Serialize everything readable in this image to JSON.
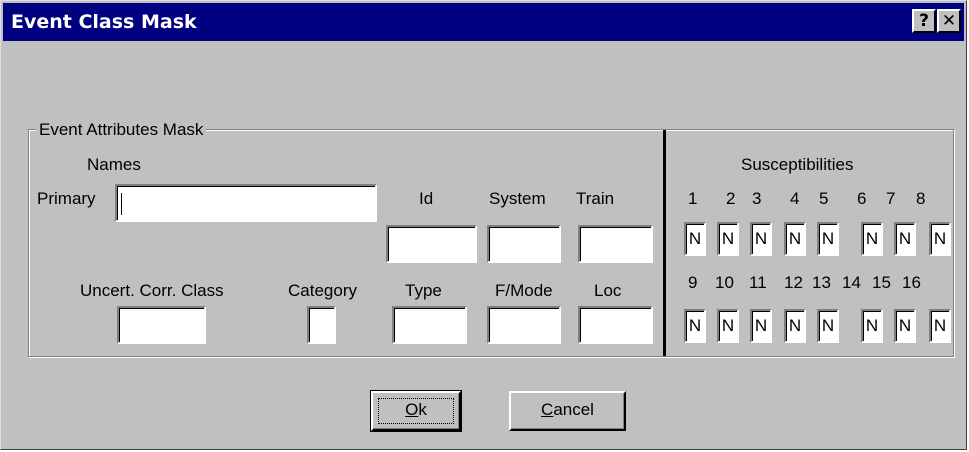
{
  "window": {
    "title": "Event Class Mask"
  },
  "titlebar_buttons": {
    "help": "?",
    "close": "✕"
  },
  "group": {
    "label": "Event Attributes Mask"
  },
  "labels": {
    "names": "Names",
    "primary": "Primary",
    "id": "Id",
    "system": "System",
    "train": "Train",
    "uncert_corr_class": "Uncert. Corr. Class",
    "category": "Category",
    "type": "Type",
    "fmode": "F/Mode",
    "loc": "Loc",
    "susceptibilities": "Susceptibilities"
  },
  "fields": {
    "primary": "",
    "id": "",
    "system": "",
    "train": "",
    "uncert_corr_class": "",
    "category": "",
    "type": "",
    "fmode": "",
    "loc": ""
  },
  "susceptibilities_row1": {
    "numbers": [
      "1",
      "2",
      "3",
      "4",
      "5",
      "6",
      "7",
      "8"
    ],
    "values": [
      "N",
      "N",
      "N",
      "N",
      "N",
      "N",
      "N",
      "N"
    ]
  },
  "susceptibilities_row2": {
    "numbers": [
      "9",
      "10",
      "11",
      "12",
      "13",
      "14",
      "15",
      "16"
    ],
    "values": [
      "N",
      "N",
      "N",
      "N",
      "N",
      "N",
      "N",
      "N"
    ]
  },
  "buttons": {
    "ok": {
      "mnemonic": "O",
      "rest": "k"
    },
    "cancel": {
      "mnemonic": "C",
      "rest": "ancel"
    }
  }
}
